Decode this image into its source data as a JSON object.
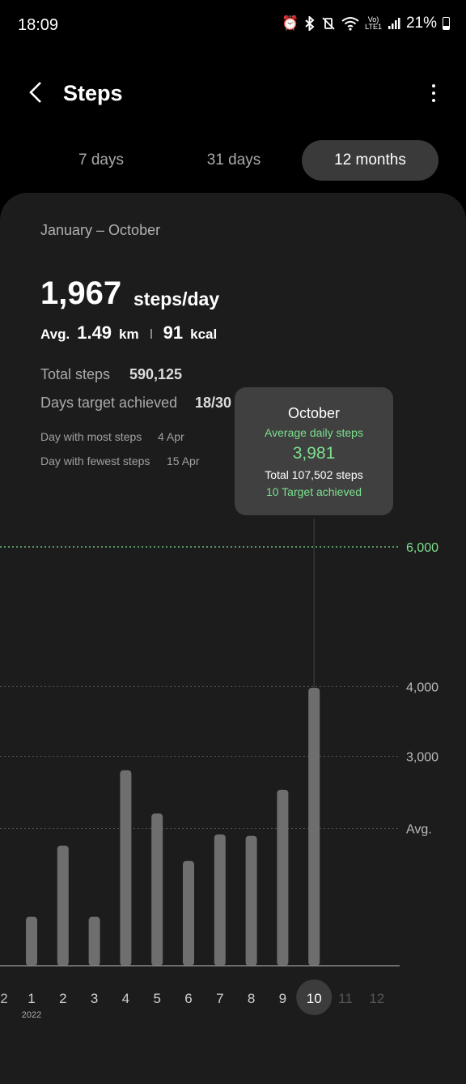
{
  "status": {
    "time": "18:09",
    "battery": "21%",
    "network": "LTE1"
  },
  "appbar": {
    "title": "Steps"
  },
  "tabs": [
    {
      "label": "7 days",
      "active": false
    },
    {
      "label": "31 days",
      "active": false
    },
    {
      "label": "12 months",
      "active": true
    }
  ],
  "summary": {
    "range": "January – October",
    "steps_per_day": "1,967",
    "unit": "steps/day",
    "avg_label": "Avg.",
    "km": "1.49",
    "km_unit": "km",
    "kcal": "91",
    "kcal_unit": "kcal",
    "total_steps_label": "Total steps",
    "total_steps": "590,125",
    "days_target_label": "Days target achieved",
    "days_target": "18/30",
    "most_label": "Day with most steps",
    "most_value": "4 Apr",
    "fewest_label": "Day with fewest steps",
    "fewest_value": "15 Apr"
  },
  "tooltip": {
    "title": "October",
    "subtitle": "Average daily steps",
    "value": "3,981",
    "total": "Total 107,502 steps",
    "target": "10 Target achieved"
  },
  "colors": {
    "accent_green": "#7be08e",
    "bar": "#6e6e6e",
    "grid": "#555555"
  },
  "chart_data": {
    "type": "bar",
    "categories": [
      "1",
      "2",
      "3",
      "4",
      "5",
      "6",
      "7",
      "8",
      "9",
      "10",
      "11",
      "12"
    ],
    "leading_label": "2",
    "year_label": "2022",
    "values": [
      700,
      1720,
      700,
      2800,
      2180,
      1500,
      1880,
      1860,
      2520,
      3981,
      0,
      0
    ],
    "selected_index": 9,
    "target": 6000,
    "target_label": "6,000",
    "average": 1967,
    "average_label": "Avg.",
    "gridlines": [
      4000,
      3000
    ],
    "gridline_labels": [
      "4,000",
      "3,000"
    ],
    "ylim": [
      0,
      6000
    ]
  }
}
